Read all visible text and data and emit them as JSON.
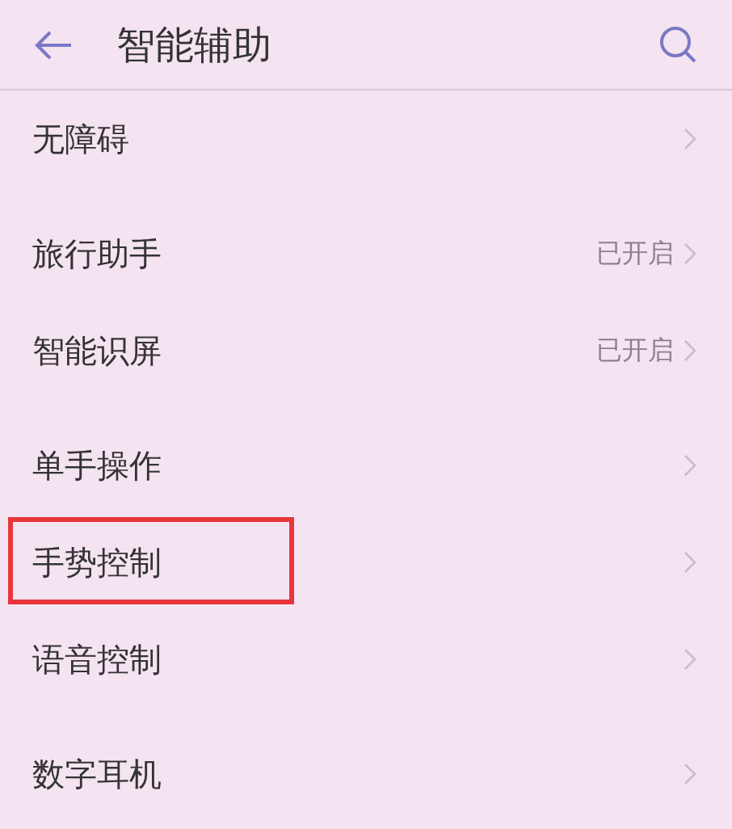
{
  "header": {
    "title": "智能辅助"
  },
  "sections": [
    {
      "items": [
        {
          "label": "无障碍",
          "highlighted": false
        }
      ]
    },
    {
      "items": [
        {
          "label": "旅行助手",
          "status": "已开启",
          "highlighted": false
        },
        {
          "label": "智能识屏",
          "status": "已开启",
          "highlighted": false
        }
      ]
    },
    {
      "items": [
        {
          "label": "单手操作",
          "highlighted": false
        },
        {
          "label": "手势控制",
          "highlighted": true
        },
        {
          "label": "语音控制",
          "highlighted": false
        }
      ]
    },
    {
      "items": [
        {
          "label": "数字耳机",
          "highlighted": false
        }
      ]
    }
  ]
}
